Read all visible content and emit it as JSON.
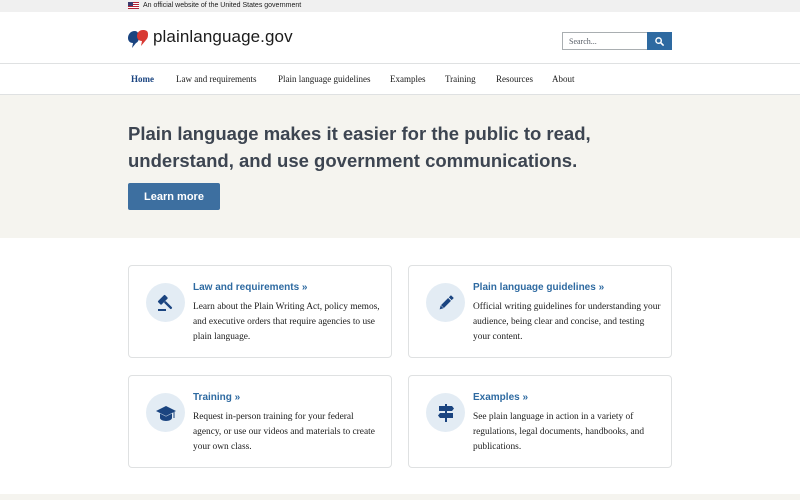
{
  "gov_banner": {
    "text": "An official website of the United States government"
  },
  "header": {
    "site_name": "plainlanguage.gov",
    "search": {
      "placeholder": "Search...",
      "value": ""
    }
  },
  "nav": {
    "items": [
      {
        "label": "Home",
        "active": true
      },
      {
        "label": "Law and requirements"
      },
      {
        "label": "Plain language guidelines"
      },
      {
        "label": "Examples"
      },
      {
        "label": "Training"
      },
      {
        "label": "Resources"
      },
      {
        "label": "About"
      }
    ]
  },
  "hero": {
    "title": "Plain language makes it easier for the public to read, understand, and use government communications.",
    "button_label": "Learn more"
  },
  "cards": [
    {
      "title": "Law and requirements »",
      "description": "Learn about the Plain Writing Act, policy memos, and executive orders that require agencies to use plain language.",
      "icon": "gavel-icon"
    },
    {
      "title": "Plain language guidelines »",
      "description": "Official writing guidelines for understanding your audience, being clear and concise, and testing your content.",
      "icon": "pencil-icon"
    },
    {
      "title": "Training »",
      "description": "Request in-person training for your federal agency, or use our videos and materials to create your own class.",
      "icon": "graduation-cap-icon"
    },
    {
      "title": "Examples »",
      "description": "See plain language in action in a variety of regulations, legal documents, handbooks, and publications.",
      "icon": "signpost-icon"
    }
  ],
  "colors": {
    "primary": "#2e6aa1",
    "hero_button": "#3d6fa0",
    "hero_background": "#f5f4ef",
    "icon_circle": "#e3ecf4",
    "nav_active": "#1a4480"
  }
}
